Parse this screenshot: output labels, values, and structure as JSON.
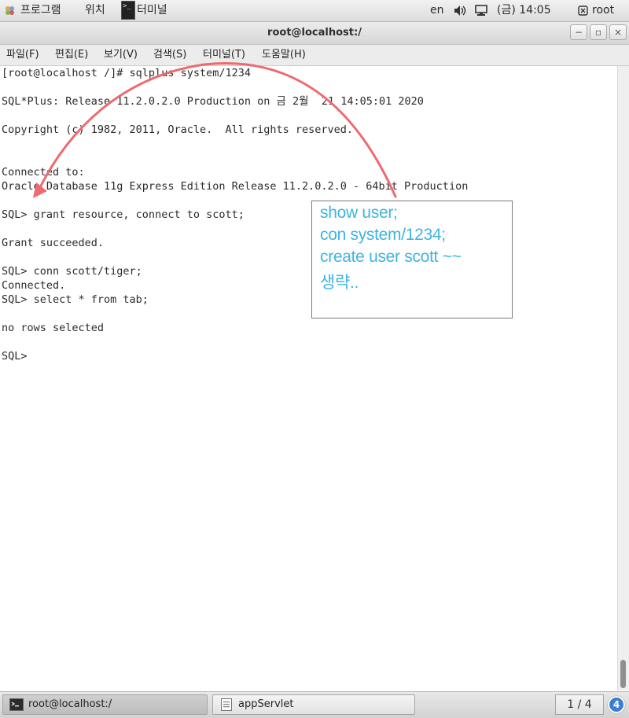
{
  "top_panel": {
    "applications": "프로그램",
    "places": "위치",
    "window_task": "터미널",
    "lang": "en",
    "clock": "(금) 14:05",
    "user": "root"
  },
  "window": {
    "title": "root@localhost:/",
    "buttons": {
      "minimize": "−",
      "maximize": "▫",
      "close": "×"
    }
  },
  "menu": [
    "파일(F)",
    "편집(E)",
    "보기(V)",
    "검색(S)",
    "터미널(T)",
    "도움말(H)"
  ],
  "terminal": {
    "lines": [
      "[root@localhost /]# sqlplus system/1234",
      "SQL*Plus: Release 11.2.0.2.0 Production on 금 2월  21 14:05:01 2020",
      "Copyright (c) 1982, 2011, Oracle.  All rights reserved.",
      "Connected to:",
      "Oracle Database 11g Express Edition Release 11.2.0.2.0 - 64bit Production",
      "SQL> grant resource, connect to scott;",
      "Grant succeeded.",
      "SQL> conn scott/tiger;",
      "Connected.",
      "SQL> select * from tab;",
      "no rows selected",
      "SQL> "
    ]
  },
  "annotation": {
    "lines": [
      "show user;",
      "con system/1234;",
      "create user scott ~~",
      "생략.."
    ],
    "color": "#3fb4e1",
    "arrow_color": "#ee6a6f"
  },
  "taskbar": {
    "tasks": [
      "root@localhost:/",
      "appServlet"
    ],
    "pager": "1 / 4",
    "notification_count": "4"
  }
}
